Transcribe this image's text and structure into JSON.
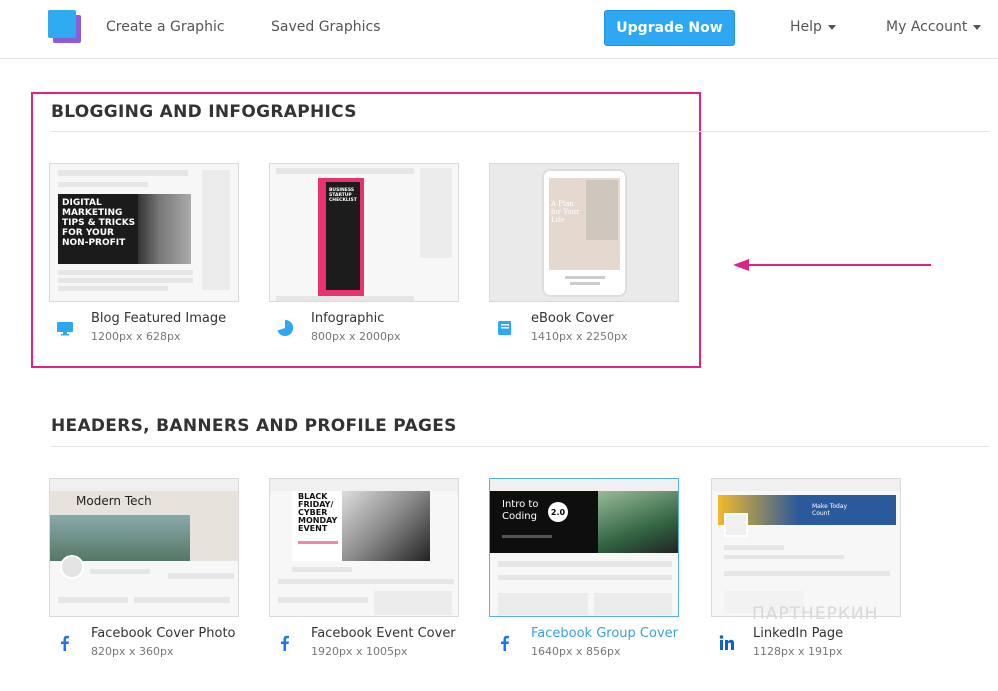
{
  "header": {
    "nav": [
      "Create a Graphic",
      "Saved Graphics"
    ],
    "upgrade_label": "Upgrade Now",
    "help_label": "Help",
    "account_label": "My Account"
  },
  "sections": [
    {
      "title": "BLOGGING AND INFOGRAPHICS",
      "cards": [
        {
          "name": "Blog Featured Image",
          "size": "1200px x 628px",
          "icon": "monitor-icon",
          "thumb_text": "DIGITAL MARKETING TIPS & TRICKS FOR YOUR NON-PROFIT"
        },
        {
          "name": "Infographic",
          "size": "800px x 2000px",
          "icon": "pie-chart-icon",
          "thumb_text": "BUSINESS STARTUP CHECKLIST"
        },
        {
          "name": "eBook Cover",
          "size": "1410px x 2250px",
          "icon": "book-icon",
          "thumb_text": "A Plan for Your Life"
        }
      ]
    },
    {
      "title": "HEADERS, BANNERS AND PROFILE PAGES",
      "cards": [
        {
          "name": "Facebook Cover Photo",
          "size": "820px x 360px",
          "icon": "facebook-icon",
          "thumb_text": "Modern Tech"
        },
        {
          "name": "Facebook Event Cover",
          "size": "1920px x 1005px",
          "icon": "facebook-icon",
          "thumb_text": "BLACK FRIDAY/ CYBER MONDAY EVENT"
        },
        {
          "name": "Facebook Group Cover",
          "size": "1640px x 856px",
          "icon": "facebook-icon",
          "thumb_text": "Intro to Coding",
          "badge": "2.0"
        },
        {
          "name": "LinkedIn Page",
          "size": "1128px x 191px",
          "icon": "linkedin-icon",
          "thumb_text": "Make Today Count"
        }
      ]
    }
  ],
  "colors": {
    "accent": "#2ea8f2",
    "highlight": "#e0218a",
    "logo_front": "#2eaaf0",
    "logo_back": "#8e5cd9"
  },
  "watermark": "ПАРТНЕРКИН"
}
